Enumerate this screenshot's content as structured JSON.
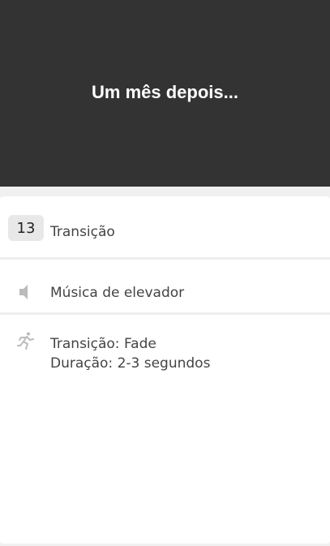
{
  "preview": {
    "title": "Um mês depois..."
  },
  "scene": {
    "number": "13",
    "label": "Transição"
  },
  "music": {
    "icon": "speaker-icon",
    "label": "Música de elevador"
  },
  "effect": {
    "icon": "running-person-icon",
    "line1": "Transição: Fade",
    "line2": "Duração: 2-3 segundos"
  },
  "colors": {
    "preview_bg": "#333333",
    "page_bg": "#f0f0f0",
    "panel_bg": "#ffffff",
    "icon_gray": "#bbbbbb",
    "text": "#444444"
  }
}
